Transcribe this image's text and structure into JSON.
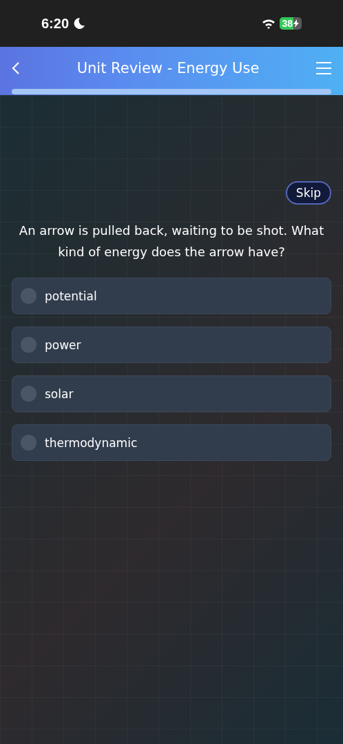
{
  "status_bar": {
    "time": "6:20",
    "battery": "38",
    "do_not_disturb": true,
    "charging": true
  },
  "header": {
    "title": "Unit Review - Energy Use"
  },
  "skip_button": "Skip",
  "question": "An arrow is pulled back, waiting to be shot. What kind of energy does the arrow have?",
  "options": [
    {
      "label": "potential",
      "selected": false
    },
    {
      "label": "power",
      "selected": false
    },
    {
      "label": "solar",
      "selected": false
    },
    {
      "label": "thermodynamic",
      "selected": false
    }
  ]
}
